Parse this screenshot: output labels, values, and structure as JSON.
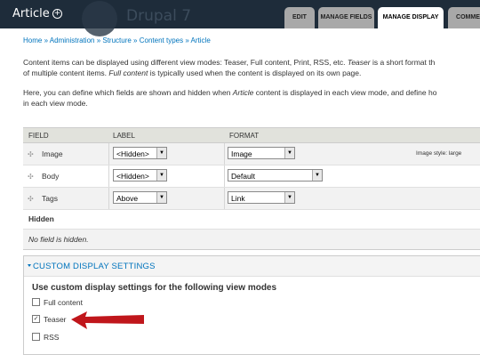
{
  "header": {
    "title": "Article",
    "add_shortcut_label": "+",
    "site_name": "Drupal 7",
    "tabs": [
      {
        "label": "EDIT",
        "active": false
      },
      {
        "label": "MANAGE FIELDS",
        "active": false
      },
      {
        "label": "MANAGE DISPLAY",
        "active": true
      },
      {
        "label": "COMMEN",
        "active": false
      }
    ]
  },
  "breadcrumb": "Home » Administration » Structure » Content types » Article",
  "description": {
    "line1_a": "Content items can be displayed using different view modes: Teaser, Full content, Print, RSS, etc. ",
    "line1_em": "Teaser",
    "line1_b": " is a short format th",
    "line2_a": "of multiple content items. ",
    "line2_em": "Full content",
    "line2_b": " is typically used when the content is displayed on its own page.",
    "line3_a": "Here, you can define which fields are shown and hidden when ",
    "line3_em": "Article",
    "line3_b": " content is displayed in each view mode, and define ho",
    "line4": "in each view mode."
  },
  "table": {
    "headers": {
      "field": "FIELD",
      "label": "LABEL",
      "format": "FORMAT"
    },
    "rows": [
      {
        "field": "Image",
        "label": "<Hidden>",
        "format": "Image",
        "summary": "Image style: large"
      },
      {
        "field": "Body",
        "label": "<Hidden>",
        "format": "Default",
        "summary": ""
      },
      {
        "field": "Tags",
        "label": "Above",
        "format": "Link",
        "summary": ""
      }
    ],
    "hidden_region_title": "Hidden",
    "hidden_empty_text": "No field is hidden."
  },
  "custom_display": {
    "legend": "CUSTOM DISPLAY SETTINGS",
    "title": "Use custom display settings for the following view modes",
    "options": [
      {
        "label": "Full content",
        "checked": false
      },
      {
        "label": "Teaser",
        "checked": true
      },
      {
        "label": "RSS",
        "checked": false
      }
    ]
  },
  "annotation": {
    "color": "#c0161b"
  }
}
